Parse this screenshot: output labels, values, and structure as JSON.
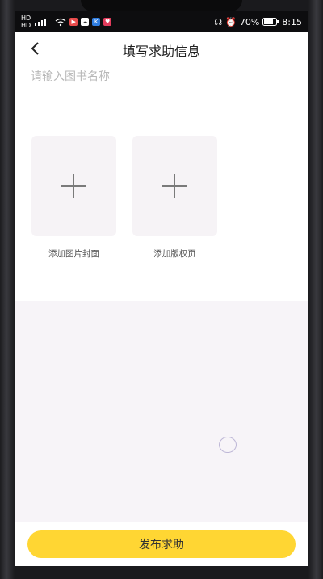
{
  "status": {
    "left_chips": [
      "HD",
      "HD"
    ],
    "battery": "70%",
    "time": "8:15"
  },
  "header": {
    "title": "填写求助信息"
  },
  "form": {
    "book_name_placeholder": "请输入图书名称",
    "tiles": [
      {
        "caption": "添加图片封面"
      },
      {
        "caption": "添加版权页"
      }
    ]
  },
  "footer": {
    "publish_label": "发布求助"
  },
  "colors": {
    "accent": "#ffd633"
  }
}
